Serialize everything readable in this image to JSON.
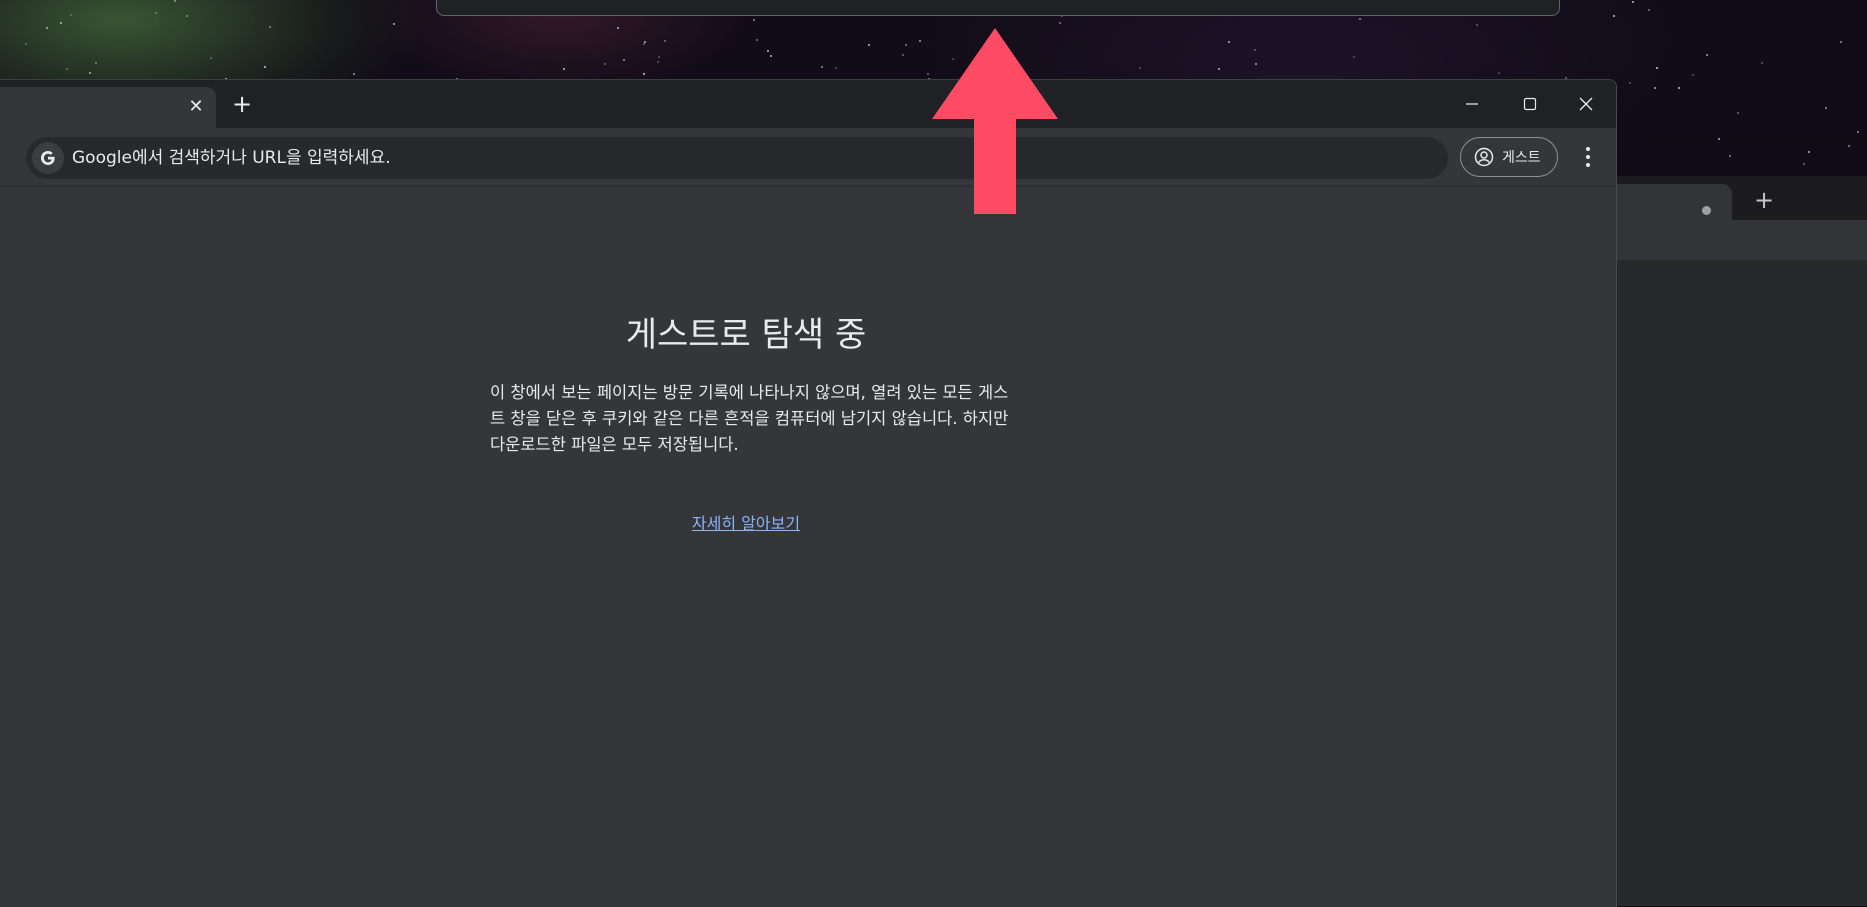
{
  "browser": {
    "tab": {
      "close_glyph": "✕"
    },
    "new_tab_glyph": "+",
    "omnibox": {
      "icon": "google-g-icon",
      "placeholder": "Google에서 검색하거나 URL을 입력하세요."
    },
    "profile": {
      "icon": "account-circle-icon",
      "label": "게스트"
    },
    "menu_icon": "more-vert-icon",
    "window_controls": [
      "minimize-icon",
      "maximize-icon",
      "close-icon"
    ]
  },
  "guest_page": {
    "title": "게스트로 탐색 중",
    "description": "이 창에서 보는 페이지는 방문 기록에 나타나지 않으며, 열려 있는 모든 게스트 창을 닫은 후 쿠키와 같은 다른 흔적을 컴퓨터에 남기지 않습니다. 하지만 다운로드한 파일은 모두 저장됩니다.",
    "learn_more": "자세히 알아보기"
  },
  "background_window": {
    "new_tab_glyph": "+"
  },
  "annotation": {
    "type": "arrow-up",
    "color": "#ff4b63"
  },
  "colors": {
    "surface": "#35363a",
    "titlebar": "#202124",
    "text": "#e8eaed",
    "link": "#8ab4f8"
  }
}
